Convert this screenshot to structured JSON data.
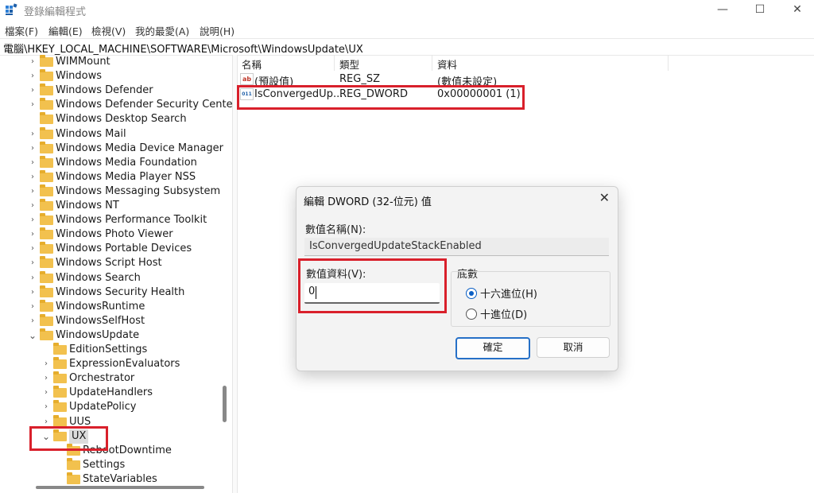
{
  "window": {
    "title": "登錄編輯程式"
  },
  "menu": [
    "檔案(F)",
    "編輯(E)",
    "檢視(V)",
    "我的最愛(A)",
    "說明(H)"
  ],
  "address": "電腦\\HKEY_LOCAL_MACHINE\\SOFTWARE\\Microsoft\\WindowsUpdate\\UX",
  "tree": [
    "WIMMount",
    "Windows",
    "Windows Defender",
    "Windows Defender Security Center",
    "Windows Desktop Search",
    "Windows Mail",
    "Windows Media Device Manager",
    "Windows Media Foundation",
    "Windows Media Player NSS",
    "Windows Messaging Subsystem",
    "Windows NT",
    "Windows Performance Toolkit",
    "Windows Photo Viewer",
    "Windows Portable Devices",
    "Windows Script Host",
    "Windows Search",
    "Windows Security Health",
    "WindowsRuntime",
    "WindowsSelfHost",
    "WindowsUpdate",
    "EditionSettings",
    "ExpressionEvaluators",
    "Orchestrator",
    "UpdateHandlers",
    "UpdatePolicy",
    "UUS",
    "UX",
    "RebootDowntime",
    "Settings",
    "StateVariables"
  ],
  "list": {
    "headers": [
      "名稱",
      "類型",
      "資料"
    ],
    "rows": [
      {
        "icon": "ab",
        "name": "(預設值)",
        "type": "REG_SZ",
        "data": "(數值未設定)"
      },
      {
        "icon": "011",
        "name": "IsConvergedUp...",
        "type": "REG_DWORD",
        "data": "0x00000001 (1)"
      }
    ]
  },
  "dialog": {
    "title": "編輯 DWORD (32-位元) 值",
    "name_label": "數值名稱(N):",
    "name_value": "IsConvergedUpdateStackEnabled",
    "data_label": "數值資料(V):",
    "data_value": "0",
    "base_label": "底數",
    "hex_label": "十六進位(H)",
    "dec_label": "十進位(D)",
    "ok_label": "確定",
    "cancel_label": "取消",
    "close_glyph": "✕"
  },
  "window_controls": {
    "minimize": "—",
    "maximize": "☐",
    "close": "✕"
  },
  "colors": {
    "highlight": "#d9202b",
    "folder": "#f2c14e",
    "accent": "#0a5fc4"
  }
}
